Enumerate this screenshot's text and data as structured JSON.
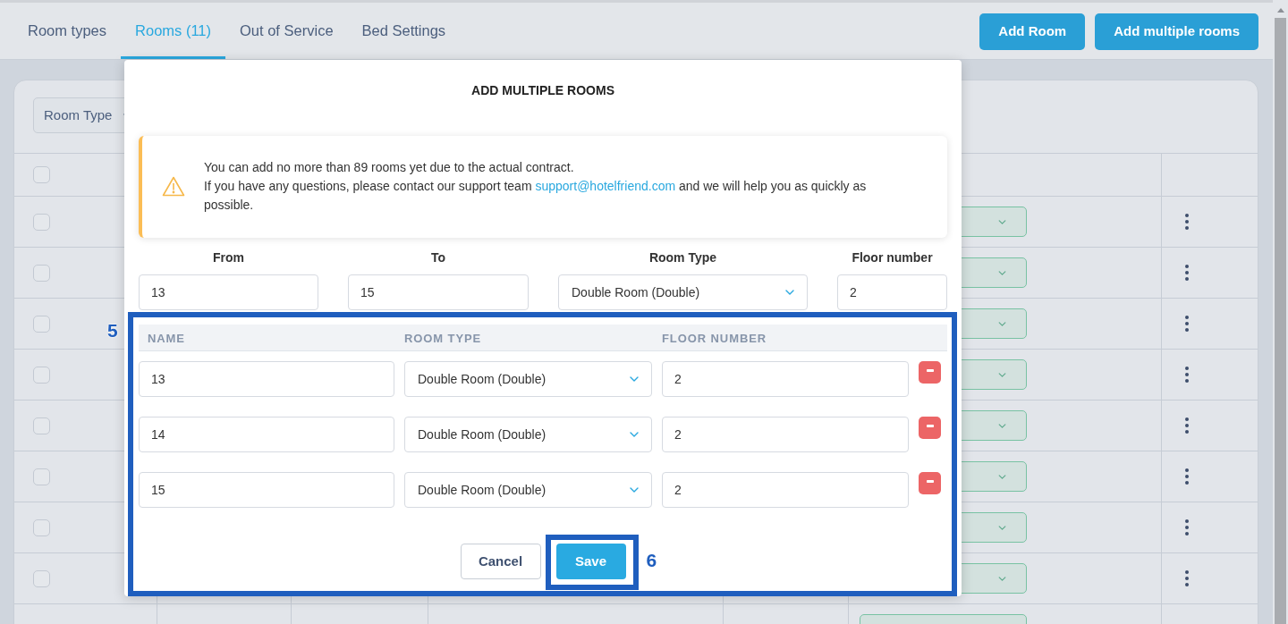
{
  "tabs": [
    {
      "label": "Room types",
      "selected": false
    },
    {
      "label": "Rooms (11)",
      "selected": true
    },
    {
      "label": "Out of Service",
      "selected": false
    },
    {
      "label": "Bed Settings",
      "selected": false
    }
  ],
  "header_buttons": [
    {
      "label": "Add Room"
    },
    {
      "label": "Add multiple rooms"
    }
  ],
  "filter": {
    "label": "Room Type"
  },
  "table": {
    "header_checked": false,
    "rows": [
      {
        "checked": false
      },
      {
        "checked": false
      },
      {
        "checked": false
      },
      {
        "checked": false
      },
      {
        "checked": false
      },
      {
        "checked": false
      },
      {
        "checked": false
      },
      {
        "checked": false
      }
    ]
  },
  "modal": {
    "title": "ADD MULTIPLE ROOMS",
    "alert": {
      "message": "You can add no more than 89 rooms yet due to the actual contract.",
      "contact_before": "If you have any questions, please contact our support team",
      "email": "support@hotelfriend.com",
      "contact_after": "and we will help you as quickly as possible."
    },
    "range_fields": [
      {
        "kind": "input",
        "label": "From",
        "value": "13"
      },
      {
        "kind": "input",
        "label": "To",
        "value": "15"
      },
      {
        "kind": "select",
        "label": "Room Type",
        "value": "Double Room (Double)"
      },
      {
        "kind": "input",
        "label": "Floor number",
        "value": "2"
      }
    ],
    "rooms_table": {
      "annotation": "5",
      "columns": [
        "NAME",
        "ROOM TYPE",
        "FLOOR NUMBER"
      ],
      "rows": [
        {
          "name": "13",
          "room_type": "Double Room (Double)",
          "floor_number": "2"
        },
        {
          "name": "14",
          "room_type": "Double Room (Double)",
          "floor_number": "2"
        },
        {
          "name": "15",
          "room_type": "Double Room (Double)",
          "floor_number": "2"
        }
      ]
    },
    "actions": [
      {
        "kind": "secondary",
        "label": "Cancel"
      },
      {
        "kind": "primary",
        "label": "Save",
        "annotation": "6"
      }
    ]
  }
}
